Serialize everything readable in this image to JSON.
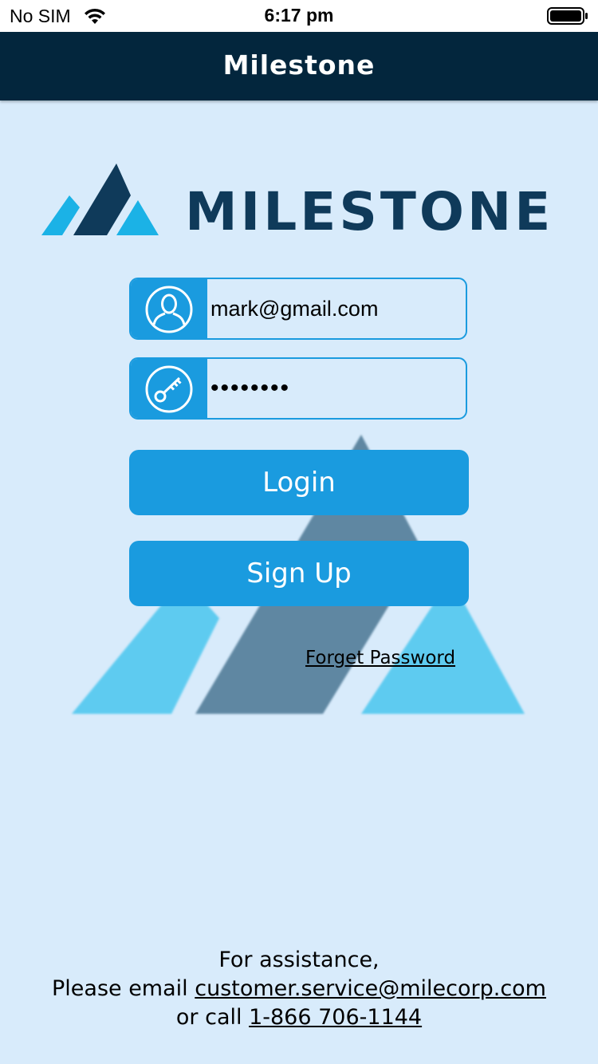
{
  "status_bar": {
    "carrier": "No SIM",
    "time": "6:17 pm",
    "wifi_icon": "wifi-icon",
    "battery_icon": "battery-icon"
  },
  "nav": {
    "title": "Milestone"
  },
  "logo": {
    "text": "MILESTONE",
    "colors": {
      "light": "#1bb2e6",
      "dark": "#0f3a5a"
    }
  },
  "login_form": {
    "email": {
      "icon": "user-icon",
      "value": "mark@gmail.com"
    },
    "password": {
      "icon": "key-icon",
      "value": "••••••••"
    },
    "login_label": "Login",
    "signup_label": "Sign Up",
    "forget_label": "Forget Password"
  },
  "footer": {
    "line1": "For assistance,",
    "line2_prefix": "Please email ",
    "email": "customer.service@milecorp.com",
    "line3_prefix": "or call ",
    "phone": "1-866 706-1144"
  },
  "colors": {
    "background": "#d8ebfb",
    "nav": "#03263d",
    "accent": "#1a9bdf"
  }
}
